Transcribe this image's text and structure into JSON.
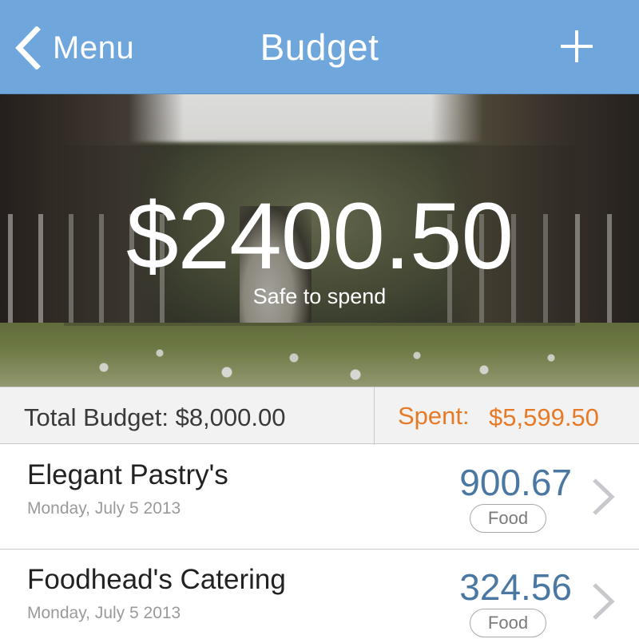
{
  "navbar": {
    "back_label": "Menu",
    "back_icon": "chevron-left-icon",
    "title": "Budget",
    "add_icon": "plus-icon"
  },
  "hero": {
    "amount": "$2400.50",
    "label": "Safe to spend"
  },
  "summary": {
    "total": "Total Budget: $8,000.00",
    "spent_label": "Spent:",
    "spent_value": "$5,599.50"
  },
  "expenses": [
    {
      "title": "Elegant Pastry's",
      "date": "Monday, July 5 2013",
      "amount": "900.67",
      "tag": "Food"
    },
    {
      "title": "Foodhead's Catering",
      "date": "Monday, July 5 2013",
      "amount": "324.56",
      "tag": "Food"
    }
  ],
  "colors": {
    "navbar": "#6fa6dc",
    "spent": "#e77a26",
    "amount": "#4a78a3"
  }
}
